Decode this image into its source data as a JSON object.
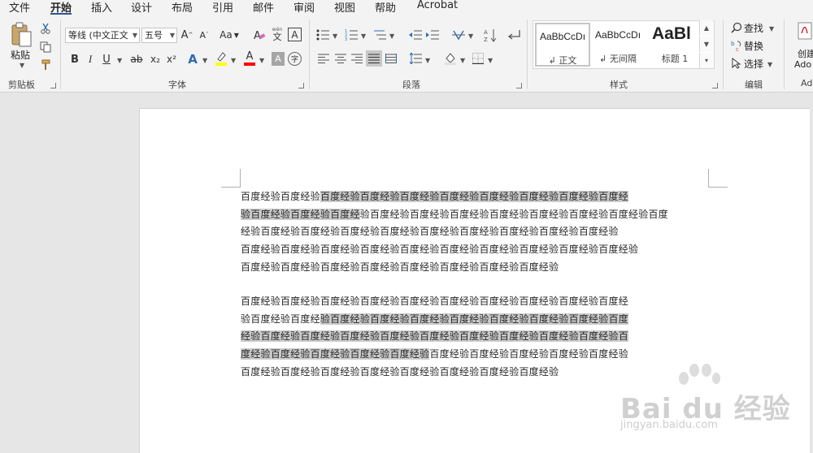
{
  "tabs": [
    {
      "label": "文件"
    },
    {
      "label": "开始",
      "active": true
    },
    {
      "label": "插入"
    },
    {
      "label": "设计"
    },
    {
      "label": "布局"
    },
    {
      "label": "引用"
    },
    {
      "label": "邮件"
    },
    {
      "label": "审阅"
    },
    {
      "label": "视图"
    },
    {
      "label": "帮助"
    },
    {
      "label": "Acrobat"
    }
  ],
  "clipboard": {
    "paste_label": "粘贴",
    "group_label": "剪贴板"
  },
  "font": {
    "font_name": "等线 (中文正文",
    "font_size": "五号",
    "change_case": "Aa",
    "group_label": "字体",
    "bold": "B",
    "italic": "I",
    "underline": "U",
    "strikethrough": "ab",
    "subscript": "x₂",
    "superscript": "x²",
    "char_border": "A",
    "phonetic_top": "wén",
    "phonetic": "文",
    "grow": "A",
    "shrink": "A",
    "effects": "A",
    "font_color": "A",
    "shade": "A",
    "enclose": "字",
    "clear": "A"
  },
  "paragraph": {
    "group_label": "段落"
  },
  "styles": {
    "group_label": "样式",
    "items": [
      {
        "sample": "AaBbCcDı",
        "name": "↲ 正文",
        "selected": true
      },
      {
        "sample": "AaBbCcDı",
        "name": "↲ 无间隔",
        "selected": false
      },
      {
        "sample": "AaBl",
        "name": "标题 1",
        "selected": false
      }
    ]
  },
  "editing": {
    "find": "查找",
    "replace": "替换",
    "select": "选择",
    "group_label": "编辑"
  },
  "acrobat": {
    "create_line1": "创建",
    "create_line2": "Ado",
    "group_partial": "Ad"
  },
  "colors": {
    "accent": "#2b579a",
    "highlight_swatch": "#ffff00",
    "font_color_swatch": "#ff0000",
    "selection_shade": "#cccccc"
  },
  "document": {
    "paragraph1": [
      {
        "segments": [
          {
            "text": "百度经验百度经验",
            "hl": false
          },
          {
            "text": "百度经验百度经验百度经验百度经验百度经验百度经验百度经验百度经",
            "hl": true
          }
        ]
      },
      {
        "segments": [
          {
            "text": "验百度经验百度经验百度经",
            "hl": true
          },
          {
            "text": "验百度经验百度经验百度经验百度经验百度经验百度经验百度经验百度",
            "hl": false
          }
        ]
      },
      {
        "segments": [
          {
            "text": "经验百度经验百度经验百度经验百度经验百度经验百度经验百度经验百度经验百度经验",
            "hl": false
          }
        ]
      },
      {
        "segments": [
          {
            "text": "百度经验百度经验百度经验百度经验百度经验百度经验百度经验百度经验百度经验百度经验",
            "hl": false
          }
        ]
      },
      {
        "segments": [
          {
            "text": "百度经验百度经验百度经验百度经验百度经验百度经验百度经验百度经验",
            "hl": false
          }
        ]
      }
    ],
    "paragraph2": [
      {
        "segments": [
          {
            "text": "百度经验百度经验百度经验百度经验百度经验百度经验百度经验百度经验百度经验百度经",
            "hl": false
          }
        ]
      },
      {
        "segments": [
          {
            "text": "验百度经验百度经",
            "hl": false
          },
          {
            "text": "验百度经验百度经验百度经验百度经验百度经验百度经验百度经验百度",
            "hl": true
          }
        ]
      },
      {
        "segments": [
          {
            "text": "经验百度经验百度经验百度经验百度经验百度经验百度经验百度经验百度经验百度经验百",
            "hl": true
          }
        ]
      },
      {
        "segments": [
          {
            "text": "度经验百度经验百度经验百度经验百度经验",
            "hl": true
          },
          {
            "text": "百度经验百度经验百度经验百度经验百度经验",
            "hl": false
          }
        ]
      },
      {
        "segments": [
          {
            "text": "百度经验百度经验百度经验百度经验百度经验百度经验百度经验百度经验",
            "hl": false
          }
        ]
      }
    ]
  },
  "watermark": {
    "logo_text": "Bai du 经验",
    "url": "jingyan.baidu.com"
  }
}
